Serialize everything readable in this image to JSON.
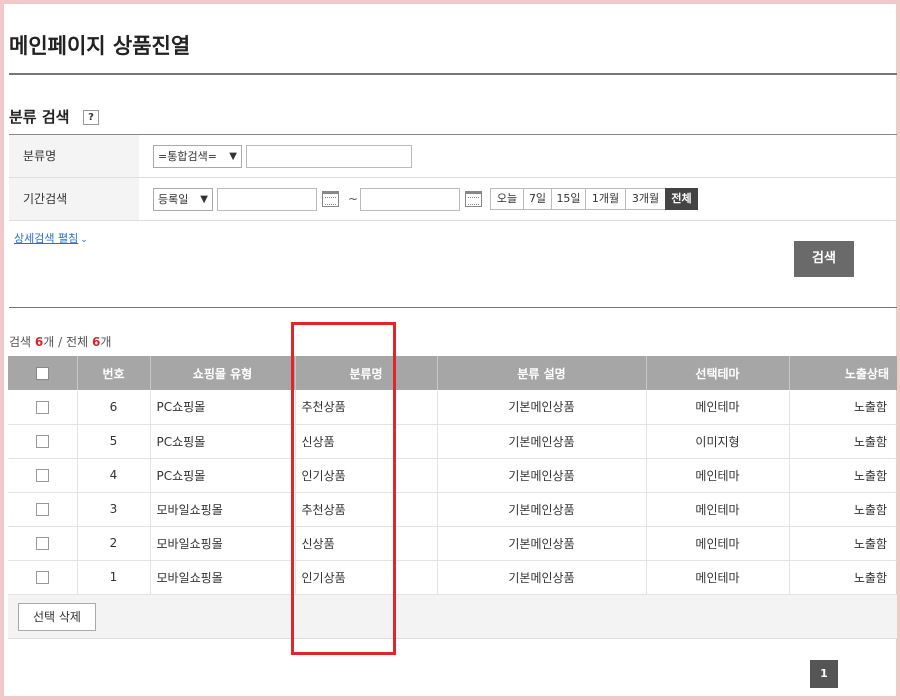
{
  "page": {
    "title": "메인페이지 상품진열"
  },
  "search": {
    "section_title": "분류 검색",
    "help_icon": "?",
    "category_label": "분류명",
    "category_select": "=통합검색=",
    "period_label": "기간검색",
    "period_select": "등록일",
    "tilde": "~",
    "period_buttons": [
      "오늘",
      "7일",
      "15일",
      "1개월",
      "3개월",
      "전체"
    ],
    "detail_link": "상세검색 펼침",
    "search_button": "검색"
  },
  "summary": {
    "search_label": "검색",
    "search_count": "6",
    "unit": "개",
    "divider": "/",
    "total_label": "전체",
    "total_count": "6"
  },
  "table": {
    "headers": [
      "번호",
      "쇼핑몰 유형",
      "분류명",
      "분류 설명",
      "선택테마",
      "노출상태"
    ],
    "rows": [
      {
        "num": "6",
        "mall": "PC쇼핑몰",
        "category": "추천상품",
        "desc": "기본메인상품",
        "theme": "메인테마",
        "status": "노출함"
      },
      {
        "num": "5",
        "mall": "PC쇼핑몰",
        "category": "신상품",
        "desc": "기본메인상품",
        "theme": "이미지형",
        "status": "노출함"
      },
      {
        "num": "4",
        "mall": "PC쇼핑몰",
        "category": "인기상품",
        "desc": "기본메인상품",
        "theme": "메인테마",
        "status": "노출함"
      },
      {
        "num": "3",
        "mall": "모바일쇼핑몰",
        "category": "추천상품",
        "desc": "기본메인상품",
        "theme": "메인테마",
        "status": "노출함"
      },
      {
        "num": "2",
        "mall": "모바일쇼핑몰",
        "category": "신상품",
        "desc": "기본메인상품",
        "theme": "메인테마",
        "status": "노출함"
      },
      {
        "num": "1",
        "mall": "모바일쇼핑몰",
        "category": "인기상품",
        "desc": "기본메인상품",
        "theme": "메인테마",
        "status": "노출함"
      }
    ]
  },
  "footer": {
    "delete_button": "선택 삭제",
    "page_current": "1"
  },
  "colors": {
    "highlight": "#e0262b",
    "count_accent": "#d7262b",
    "header_bg": "#a6a6a6",
    "frame": "#f2c9c9"
  }
}
